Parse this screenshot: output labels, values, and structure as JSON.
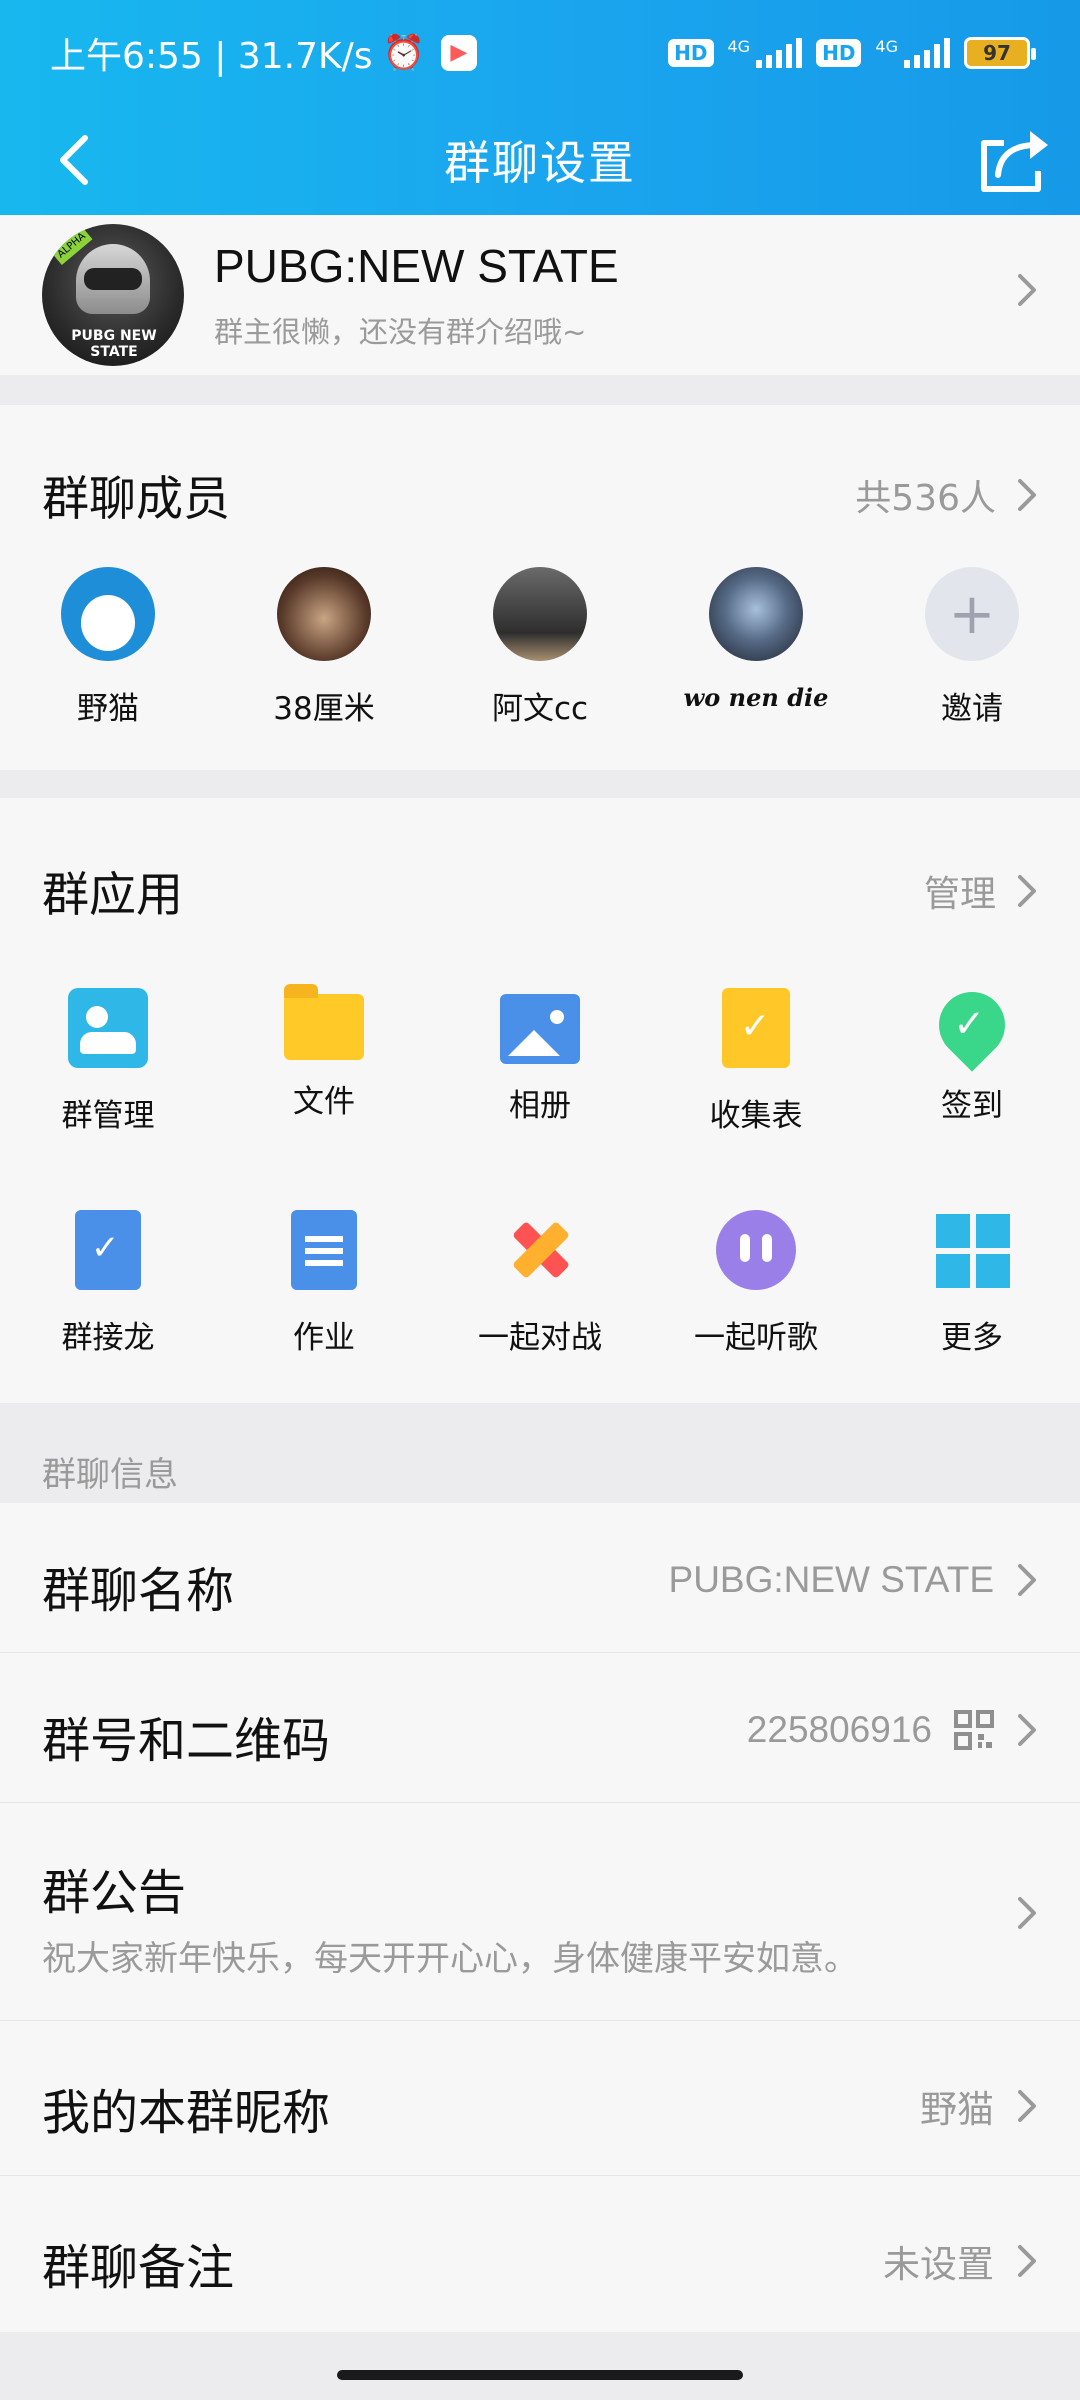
{
  "status_bar": {
    "time": "上午6:55 | 31.7K/s",
    "alarm_icon": "alarm-icon",
    "network_left": "4G",
    "network_right": "4G",
    "hd": "HD",
    "battery": "97"
  },
  "nav": {
    "title": "群聊设置"
  },
  "group": {
    "name": "PUBG:NEW STATE",
    "description": "群主很懒，还没有群介绍哦~",
    "avatar_badge": "ALPHA",
    "avatar_logo": "PUBG NEW STATE"
  },
  "members": {
    "title": "群聊成员",
    "count": "共536人",
    "list": [
      {
        "name": "野猫"
      },
      {
        "name": "38厘米"
      },
      {
        "name": "阿文cc"
      },
      {
        "name": "wo nen die"
      },
      {
        "name": "邀请"
      }
    ]
  },
  "apps": {
    "title": "群应用",
    "manage": "管理",
    "row1": [
      {
        "label": "群管理",
        "icon": "group-manage-icon"
      },
      {
        "label": "文件",
        "icon": "folder-icon"
      },
      {
        "label": "相册",
        "icon": "album-icon"
      },
      {
        "label": "收集表",
        "icon": "collect-form-icon"
      },
      {
        "label": "签到",
        "icon": "check-in-icon"
      }
    ],
    "row2": [
      {
        "label": "群接龙",
        "icon": "relay-icon"
      },
      {
        "label": "作业",
        "icon": "homework-icon"
      },
      {
        "label": "一起对战",
        "icon": "battle-icon"
      },
      {
        "label": "一起听歌",
        "icon": "music-icon"
      },
      {
        "label": "更多",
        "icon": "more-grid-icon"
      }
    ]
  },
  "info": {
    "section_label": "群聊信息",
    "rows": [
      {
        "label": "群聊名称",
        "value": "PUBG:NEW STATE"
      },
      {
        "label": "群号和二维码",
        "value": "225806916"
      },
      {
        "label": "群公告",
        "value": "祝大家新年快乐，每天开开心心，身体健康平安如意。"
      },
      {
        "label": "我的本群昵称",
        "value": "野猫"
      },
      {
        "label": "群聊备注",
        "value": "未设置"
      }
    ]
  },
  "colors": {
    "header_gradient_start": "#18b8ef",
    "header_gradient_end": "#169ae8",
    "background": "#f7f7f7",
    "secondary_text": "#9a9a9a"
  }
}
